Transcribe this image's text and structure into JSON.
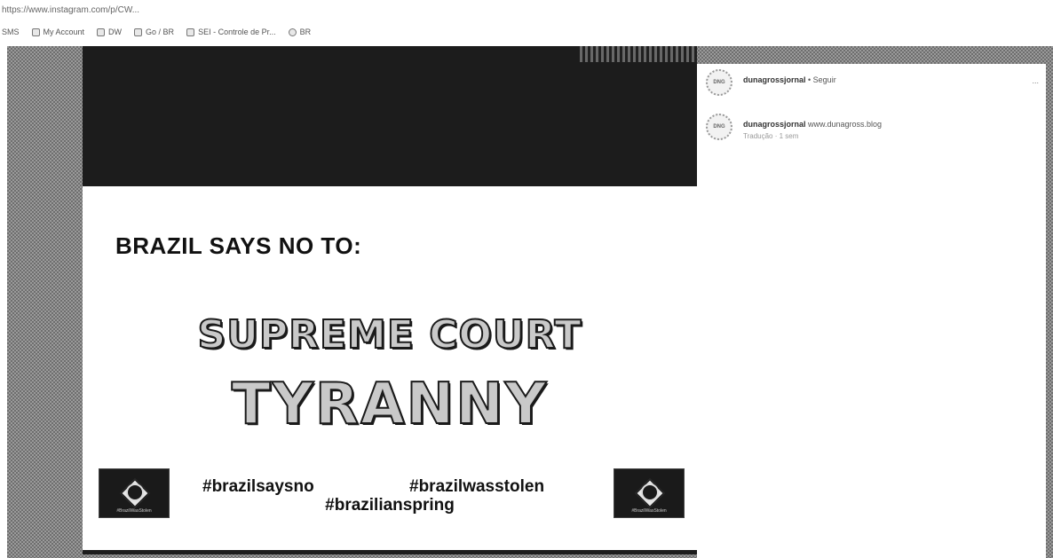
{
  "browser": {
    "url": "https://www.instagram.com/p/CW...",
    "bookmarks": [
      {
        "label": "SMS",
        "icon": "none"
      },
      {
        "label": "My Account",
        "icon": "grid-icon"
      },
      {
        "label": "DW",
        "icon": "page-icon"
      },
      {
        "label": "Go / BR",
        "icon": "page-icon"
      },
      {
        "label": "SEI - Controle de Pr...",
        "icon": "grid-icon"
      },
      {
        "label": "BR",
        "icon": "globe-icon"
      }
    ]
  },
  "post": {
    "headline_small": "BRAZIL SAYS NO TO:",
    "headline_line1": "SUPREME COURT",
    "headline_line2": "TYRANNY",
    "hashtag_1": "#brazilsaysno",
    "hashtag_2": "#brazilwasstolen",
    "hashtag_3": "#brazilianspring",
    "flag_caption": "#BrazilWasStolen"
  },
  "comments": {
    "author_header": {
      "username": "dunagrossjornal",
      "separator": " • ",
      "action": "Seguir",
      "more": "..."
    },
    "caption": {
      "username": "dunagrossjornal",
      "text": " www.dunagross.blog",
      "meta": "Tradução · 1 sem"
    },
    "avatar_text": "DNG"
  },
  "colors": {
    "backdrop": "#9a9a9a",
    "post_bar": "#1c1c1c",
    "panel": "#ffffff"
  }
}
